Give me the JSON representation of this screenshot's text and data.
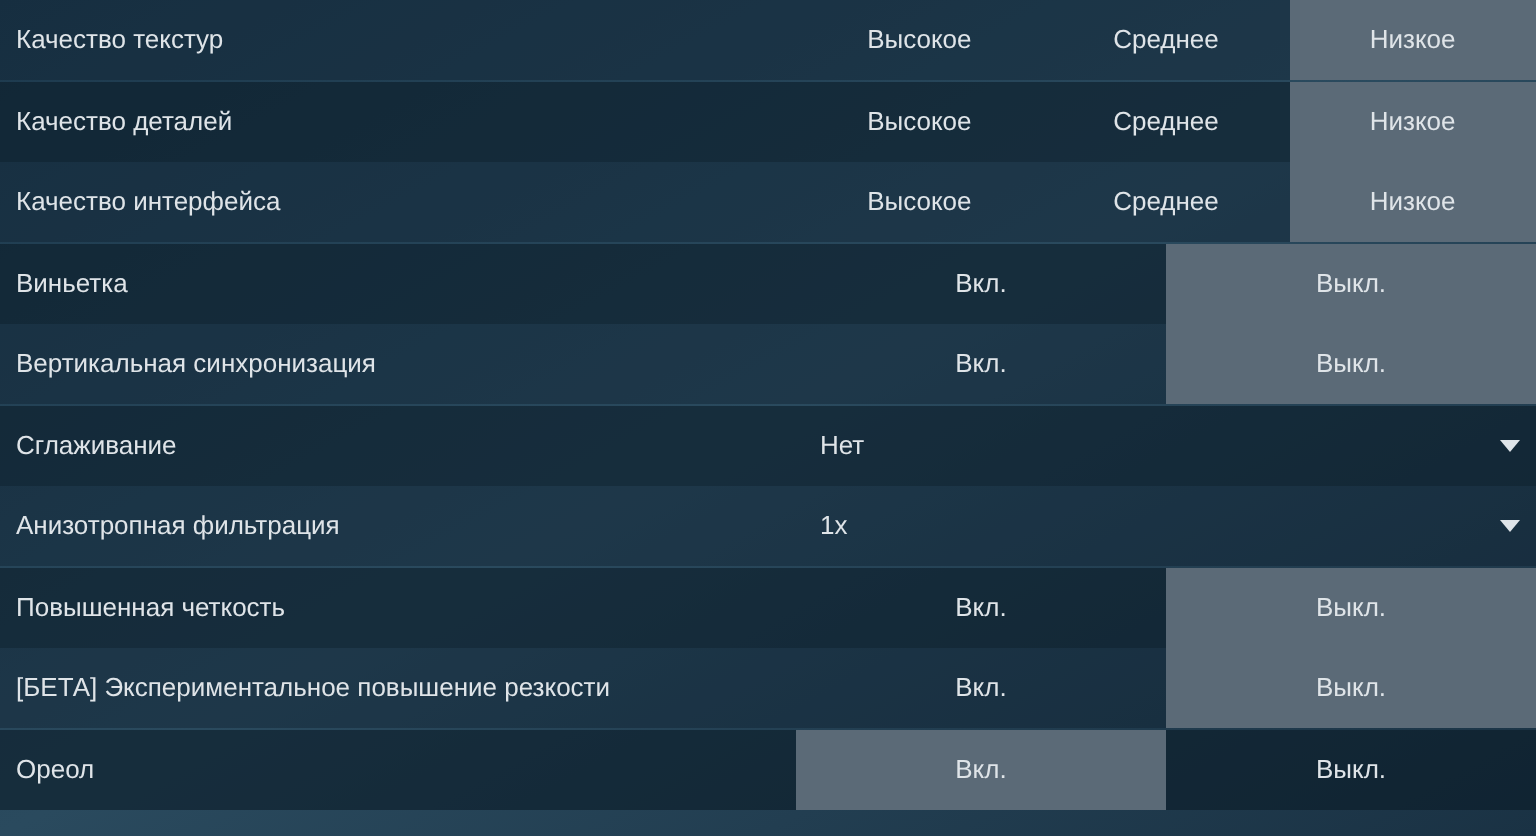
{
  "settings": [
    {
      "kind": "choice",
      "label": "Качество текстур",
      "options": [
        {
          "label": "Высокое",
          "selected": false
        },
        {
          "label": "Среднее",
          "selected": false
        },
        {
          "label": "Низкое",
          "selected": true
        }
      ]
    },
    {
      "kind": "choice",
      "label": "Качество деталей",
      "options": [
        {
          "label": "Высокое",
          "selected": false
        },
        {
          "label": "Среднее",
          "selected": false
        },
        {
          "label": "Низкое",
          "selected": true
        }
      ]
    },
    {
      "kind": "choice",
      "label": "Качество интерфейса",
      "options": [
        {
          "label": "Высокое",
          "selected": false
        },
        {
          "label": "Среднее",
          "selected": false
        },
        {
          "label": "Низкое",
          "selected": true
        }
      ]
    },
    {
      "kind": "choice",
      "label": "Виньетка",
      "options": [
        {
          "label": "Вкл.",
          "selected": false
        },
        {
          "label": "Выкл.",
          "selected": true
        }
      ]
    },
    {
      "kind": "choice",
      "label": "Вертикальная синхронизация",
      "options": [
        {
          "label": "Вкл.",
          "selected": false
        },
        {
          "label": "Выкл.",
          "selected": true
        }
      ]
    },
    {
      "kind": "dropdown",
      "label": "Сглаживание",
      "value": "Нет"
    },
    {
      "kind": "dropdown",
      "label": "Анизотропная фильтрация",
      "value": "1x"
    },
    {
      "kind": "choice",
      "label": "Повышенная четкость",
      "options": [
        {
          "label": "Вкл.",
          "selected": false
        },
        {
          "label": "Выкл.",
          "selected": true
        }
      ]
    },
    {
      "kind": "choice",
      "label": "[БЕТА] Экспериментальное повышение резкости",
      "options": [
        {
          "label": "Вкл.",
          "selected": false
        },
        {
          "label": "Выкл.",
          "selected": true
        }
      ]
    },
    {
      "kind": "choice",
      "label": "Ореол",
      "options": [
        {
          "label": "Вкл.",
          "selected": true
        },
        {
          "label": "Выкл.",
          "selected": false
        }
      ]
    }
  ]
}
